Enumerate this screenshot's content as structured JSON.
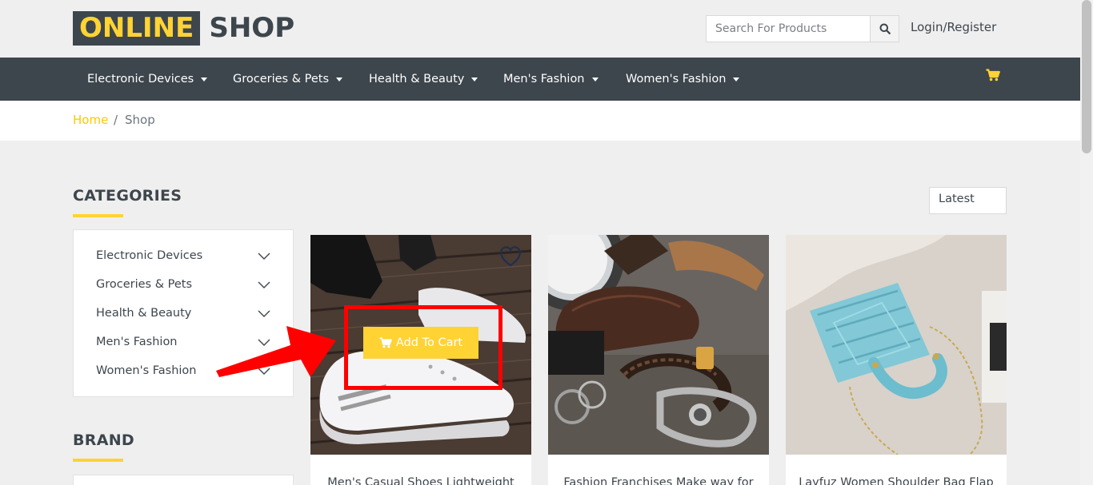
{
  "header": {
    "logo_highlight": "ONLINE",
    "logo_text": "SHOP",
    "search_placeholder": "Search For Products",
    "login_label": "Login/Register"
  },
  "nav": {
    "items": [
      {
        "label": "Electronic Devices"
      },
      {
        "label": "Groceries & Pets"
      },
      {
        "label": "Health & Beauty"
      },
      {
        "label": "Men's Fashion"
      },
      {
        "label": "Women's Fashion"
      }
    ]
  },
  "breadcrumb": {
    "home": "Home",
    "separator": "/",
    "current": "Shop"
  },
  "sidebar": {
    "categories_title": "CATEGORIES",
    "categories": [
      {
        "label": "Electronic Devices"
      },
      {
        "label": "Groceries & Pets"
      },
      {
        "label": "Health & Beauty"
      },
      {
        "label": "Men's Fashion"
      },
      {
        "label": "Women's Fashion"
      }
    ],
    "brand_title": "BRAND"
  },
  "sort": {
    "selected": "Latest"
  },
  "products": [
    {
      "title": "Men's Casual Shoes Lightweight",
      "add_to_cart": "Add To Cart"
    },
    {
      "title": "Fashion Franchises Make way for"
    },
    {
      "title": "Layfuz Women Shoulder Bag Flap"
    }
  ],
  "colors": {
    "accent": "#ffd333",
    "dark": "#3d464d",
    "highlight": "#ff0000"
  }
}
